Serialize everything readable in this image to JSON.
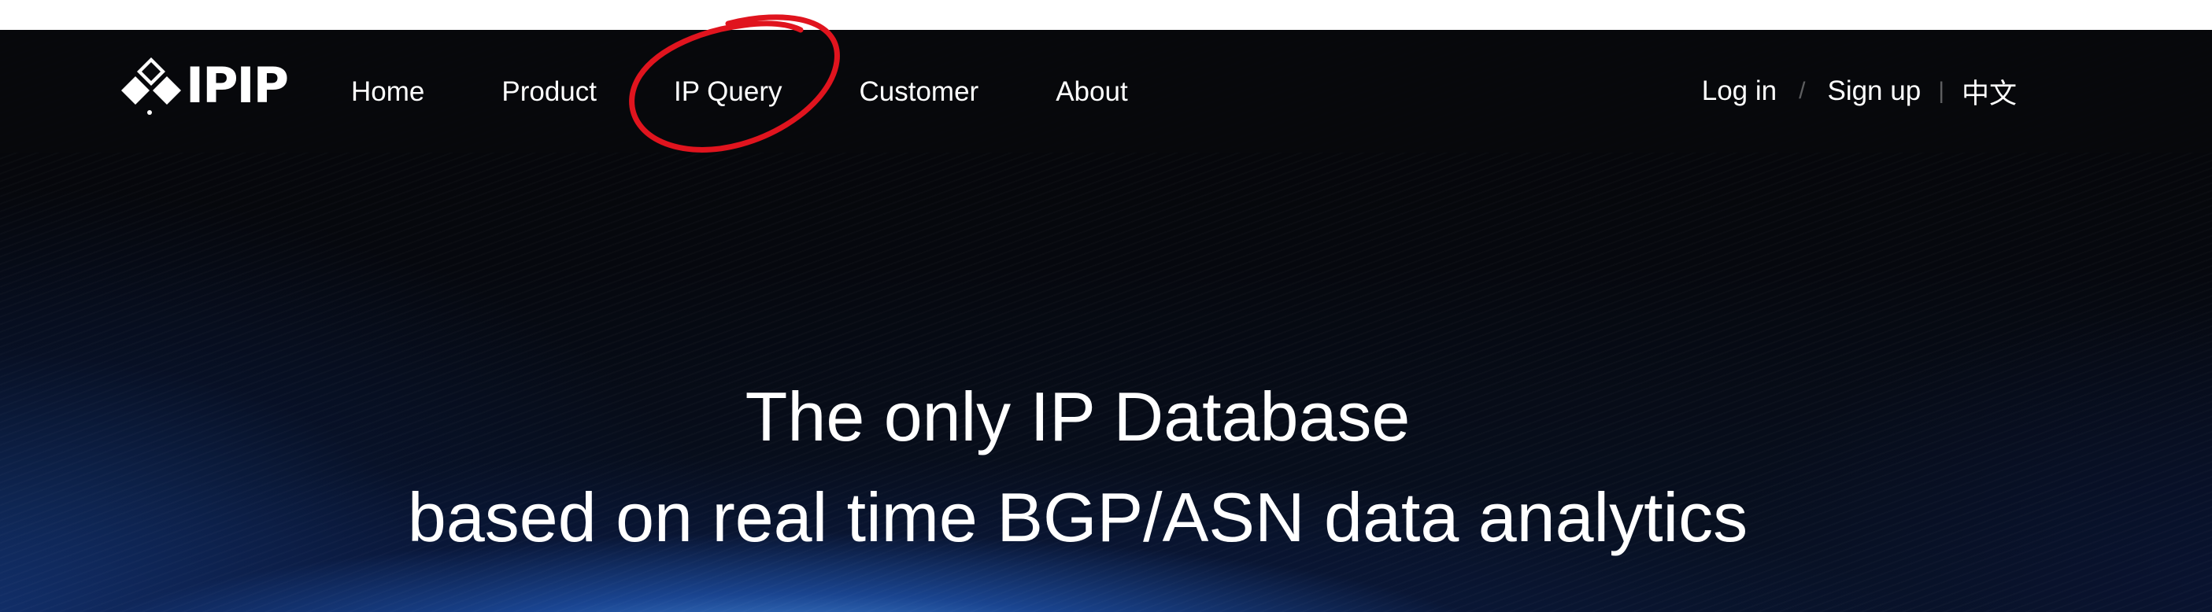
{
  "brand": {
    "logo_text": "IPIP",
    "logo_icon": "ipip-diamond-logo-icon"
  },
  "nav": {
    "items": [
      {
        "label": "Home"
      },
      {
        "label": "Product"
      },
      {
        "label": "IP Query"
      },
      {
        "label": "Customer"
      },
      {
        "label": "About"
      }
    ],
    "highlighted": "IP Query",
    "annotation_color": "#e0141e"
  },
  "auth": {
    "login": "Log in",
    "signup": "Sign up",
    "language": "中文",
    "slash": "/",
    "bar": "|"
  },
  "hero": {
    "line1": "The only IP Database",
    "line2": "based on real time BGP/ASN data analytics"
  }
}
